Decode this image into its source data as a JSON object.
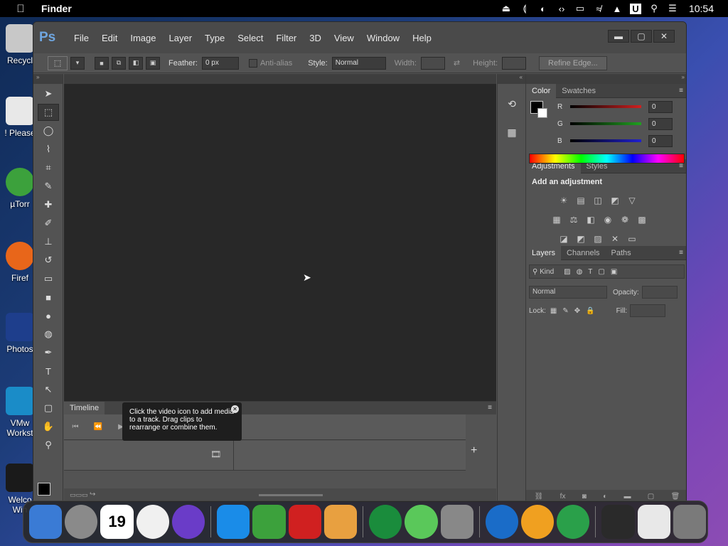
{
  "menubar": {
    "apple_icon": "apple-icon",
    "app_name": "Finder",
    "clock": "10:54",
    "status_icons": [
      "upload-icon",
      "bracket-icon",
      "contrast-icon",
      "code-icon",
      "display-icon",
      "wifi-off-icon",
      "eject-icon",
      "u-icon",
      "search-icon",
      "control-center-icon"
    ],
    "u_icon_label": "U"
  },
  "desktop": {
    "icons": [
      {
        "label": "Recycl",
        "icon": "recycle-bin-icon",
        "color": "#c8c8c8"
      },
      {
        "label": "! Please",
        "icon": "notepad-icon",
        "color": "#e8e8e8"
      },
      {
        "label": "µTorr",
        "icon": "utorrent-icon",
        "color": "#3ca13c"
      },
      {
        "label": "Firef",
        "icon": "firefox-icon",
        "color": "#e8661a"
      },
      {
        "label": "Photos",
        "icon": "photoshop-icon",
        "color": "#1e3e8c"
      },
      {
        "label": "VMw\nWorkst",
        "icon": "vmware-icon",
        "color": "#1a8cc8"
      },
      {
        "label": "Welco\nWin",
        "icon": "windows-icon",
        "color": "#1a1a1a"
      }
    ]
  },
  "photoshop": {
    "logo": "Ps",
    "menu": [
      "File",
      "Edit",
      "Image",
      "Layer",
      "Type",
      "Select",
      "Filter",
      "3D",
      "View",
      "Window",
      "Help"
    ],
    "window_buttons": [
      "minimize",
      "maximize",
      "close"
    ],
    "window_button_glyphs": [
      "▬",
      "▢",
      "✕"
    ],
    "options": {
      "feather_label": "Feather:",
      "feather_value": "0 px",
      "antialias_label": "Anti-alias",
      "style_label": "Style:",
      "style_value": "Normal",
      "width_label": "Width:",
      "height_label": "Height:",
      "refine_edge": "Refine Edge..."
    },
    "tools": [
      "move-tool-icon",
      "marquee-tool-icon",
      "lasso-tool-icon",
      "quick-select-tool-icon",
      "crop-tool-icon",
      "eyedropper-tool-icon",
      "healing-brush-tool-icon",
      "brush-tool-icon",
      "clone-stamp-tool-icon",
      "history-brush-tool-icon",
      "eraser-tool-icon",
      "gradient-tool-icon",
      "blur-tool-icon",
      "dodge-tool-icon",
      "pen-tool-icon",
      "type-tool-icon",
      "path-select-tool-icon",
      "rectangle-tool-icon",
      "hand-tool-icon",
      "zoom-tool-icon"
    ],
    "tool_glyphs": [
      "➤",
      "⬚",
      "◯",
      "⌇",
      "⌗",
      "✎",
      "✚",
      "✐",
      "⊥",
      "↺",
      "▭",
      "■",
      "●",
      "◍",
      "✒",
      "T",
      "↖",
      "▢",
      "✋",
      "⚲"
    ],
    "timeline": {
      "tab": "Timeline",
      "tooltip": "Click the video icon to add media to a track. Drag clips to rearrange or combine them."
    },
    "color_panel": {
      "tabs": [
        "Color",
        "Swatches"
      ],
      "channels": [
        {
          "name": "R",
          "value": "0",
          "color": "#d02020"
        },
        {
          "name": "G",
          "value": "0",
          "color": "#20a020"
        },
        {
          "name": "B",
          "value": "0",
          "color": "#2020d0"
        }
      ]
    },
    "adjustments_panel": {
      "tabs": [
        "Adjustments",
        "Styles"
      ],
      "title": "Add an adjustment",
      "rows": [
        [
          "brightness-icon",
          "levels-icon",
          "curves-icon",
          "exposure-icon",
          "vibrance-icon"
        ],
        [
          "hue-saturation-icon",
          "color-balance-icon",
          "black-white-icon",
          "photo-filter-icon",
          "channel-mixer-icon",
          "color-lookup-icon"
        ],
        [
          "invert-icon",
          "posterize-icon",
          "threshold-icon",
          "selective-color-icon",
          "gradient-map-icon"
        ]
      ],
      "glyphs": [
        [
          "☀",
          "▤",
          "◫",
          "◩",
          "▽"
        ],
        [
          "▦",
          "⚖",
          "◧",
          "◉",
          "❁",
          "▩"
        ],
        [
          "◪",
          "◩",
          "▨",
          "✕",
          "▭"
        ]
      ]
    },
    "layers_panel": {
      "tabs": [
        "Layers",
        "Channels",
        "Paths"
      ],
      "filter_label": "Kind",
      "blend_mode": "Normal",
      "opacity_label": "Opacity:",
      "lock_label": "Lock:",
      "fill_label": "Fill:"
    }
  },
  "dock": {
    "apps": [
      {
        "name": "finder-icon",
        "color": "#3a7bd5"
      },
      {
        "name": "launchpad-icon",
        "color": "#8a8a8a"
      },
      {
        "name": "calendar-icon",
        "color": "#ffffff",
        "label": "19"
      },
      {
        "name": "clock-icon",
        "color": "#f0f0f0"
      },
      {
        "name": "siri-icon",
        "color": "#6a3cc8"
      },
      {
        "name": "safari-icon",
        "color": "#1a8ce8"
      },
      {
        "name": "utorrent-icon",
        "color": "#3ca13c"
      },
      {
        "name": "parallels-icon",
        "color": "#d02020"
      },
      {
        "name": "preview-icon",
        "color": "#e8a040"
      },
      {
        "name": "collabsys-icon",
        "color": "#1a8c3c"
      },
      {
        "name": "link-icon",
        "color": "#5ac85a"
      },
      {
        "name": "utilities-icon",
        "color": "#888888"
      },
      {
        "name": "www-icon",
        "color": "#1a6cc8"
      },
      {
        "name": "downloader-icon",
        "color": "#f0a020"
      },
      {
        "name": "network-icon",
        "color": "#2aa04a"
      },
      {
        "name": "window-thumb-1-icon",
        "color": "#2a2a2a"
      },
      {
        "name": "window-thumb-2-icon",
        "color": "#e8e8e8"
      },
      {
        "name": "trash-icon",
        "color": "#7a7a7a"
      }
    ]
  }
}
